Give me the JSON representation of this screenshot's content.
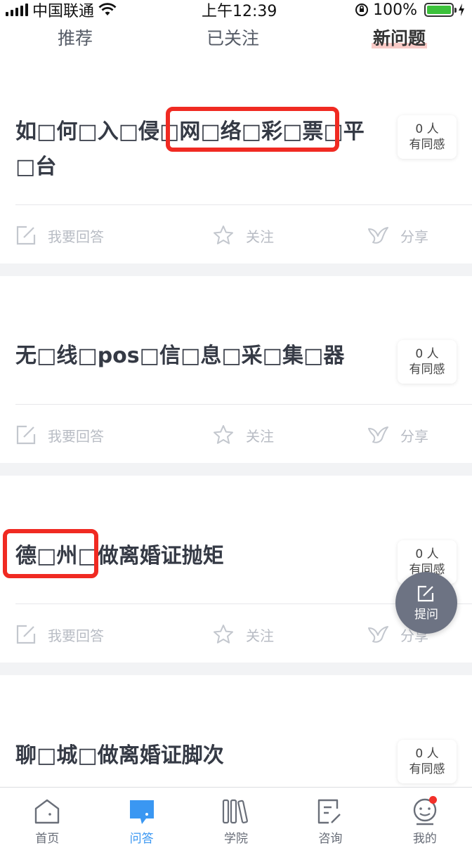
{
  "status_bar": {
    "carrier": "中国联通",
    "time": "上午12:39",
    "battery": "100%"
  },
  "tabs": [
    {
      "label": "推荐",
      "active": false
    },
    {
      "label": "已关注",
      "active": false
    },
    {
      "label": "新问题",
      "active": true
    }
  ],
  "questions": [
    {
      "title": "如□何□入□侵□网□络□彩□票□平□台",
      "resonance_count": "0 人",
      "resonance_label": "有同感"
    },
    {
      "title": "无□线□pos□信□息□采□集□器",
      "resonance_count": "0 人",
      "resonance_label": "有同感"
    },
    {
      "title": "德□州□做离婚证抛矩",
      "resonance_count": "0 人",
      "resonance_label": "有同感"
    },
    {
      "title": "聊□城□做离婚证脚次",
      "resonance_count": "0 人",
      "resonance_label": "有同感"
    }
  ],
  "actions": {
    "answer": "我要回答",
    "follow": "关注",
    "share": "分享"
  },
  "fab": {
    "label": "提问"
  },
  "tabbar": [
    {
      "label": "首页",
      "icon": "home-icon",
      "active": false
    },
    {
      "label": "问答",
      "icon": "qa-chat-icon",
      "active": true
    },
    {
      "label": "学院",
      "icon": "books-icon",
      "active": false
    },
    {
      "label": "咨询",
      "icon": "consult-icon",
      "active": false
    },
    {
      "label": "我的",
      "icon": "profile-face-icon",
      "active": false,
      "badge": true
    }
  ],
  "colors": {
    "accent": "#3a97f2",
    "highlight_box": "#f02a22",
    "separator": "#f2f3f5",
    "fab": "#6d7383"
  }
}
